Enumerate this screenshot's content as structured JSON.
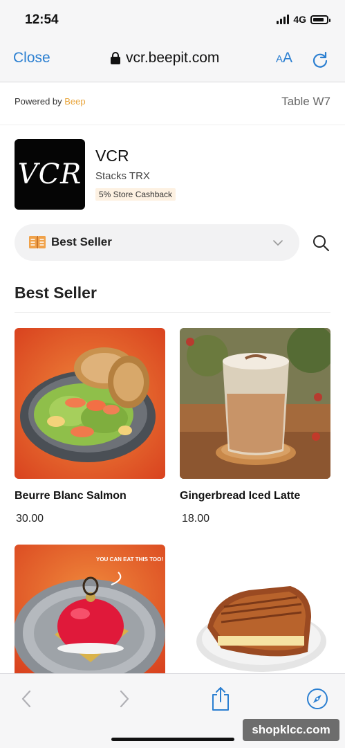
{
  "status": {
    "time": "12:54",
    "network": "4G"
  },
  "browser": {
    "close_label": "Close",
    "url": "vcr.beepit.com",
    "aa_small": "A",
    "aa_big": "A"
  },
  "header": {
    "powered_prefix": "Powered by ",
    "powered_brand": "Beep",
    "table": "Table W7"
  },
  "store": {
    "logo_text": "VCR",
    "name": "VCR",
    "location": "Stacks TRX",
    "cashback": "5% Store Cashback"
  },
  "category": {
    "selected": "Best Seller",
    "icon": "book-icon"
  },
  "section": {
    "title": "Best Seller"
  },
  "products": [
    {
      "name": "Beurre Blanc Salmon",
      "price": "30.00"
    },
    {
      "name": "Gingerbread Iced Latte",
      "price": "18.00"
    },
    {
      "badge": "YOU CAN EAT THIS TOO!"
    },
    {}
  ],
  "watermark": "shopklcc.com",
  "colors": {
    "accent": "#2b7fd1",
    "brand": "#e8a43a",
    "card_orange": "#e0572a"
  }
}
